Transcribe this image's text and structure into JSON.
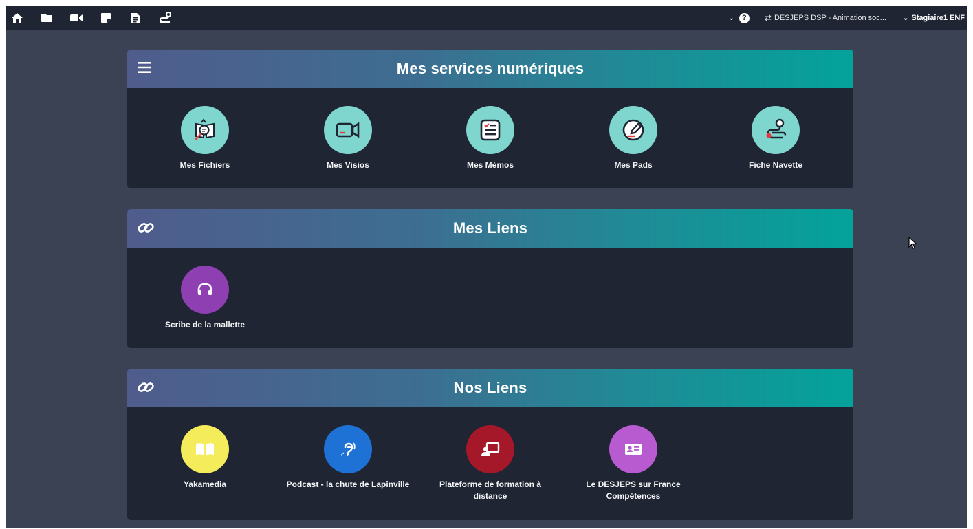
{
  "topbar": {
    "nav_icons": [
      "home-icon",
      "folder-icon",
      "video-camera-icon",
      "sticky-note-icon",
      "document-icon",
      "route-icon"
    ],
    "help_label": "?",
    "context_label": "DESJEPS DSP - Animation soc...",
    "user_label": "Stagiaire1 ENF"
  },
  "services": {
    "title": "Mes services numériques",
    "tiles": [
      {
        "label": "Mes Fichiers",
        "icon": "book-search-icon",
        "color": "#7ed6cf"
      },
      {
        "label": "Mes Visios",
        "icon": "video-icon",
        "color": "#7ed6cf"
      },
      {
        "label": "Mes Mémos",
        "icon": "memo-icon",
        "color": "#7ed6cf"
      },
      {
        "label": "Mes Pads",
        "icon": "pad-icon",
        "color": "#7ed6cf"
      },
      {
        "label": "Fiche Navette",
        "icon": "route-icon",
        "color": "#7ed6cf"
      }
    ]
  },
  "my_links": {
    "title": "Mes Liens",
    "tiles": [
      {
        "label": "Scribe de la mallette",
        "icon": "headphones-icon",
        "color": "#8e3fb2"
      }
    ]
  },
  "our_links": {
    "title": "Nos Liens",
    "tiles": [
      {
        "label": "Yakamedia",
        "icon": "book-open-icon",
        "color": "#f5ec5b"
      },
      {
        "label": "Podcast - la chute de Lapinville",
        "icon": "ear-icon",
        "color": "#1e72d6"
      },
      {
        "label": "Plateforme de formation à distance",
        "icon": "teacher-board-icon",
        "color": "#a5182a"
      },
      {
        "label": "Le DESJEPS sur France Compétences",
        "icon": "id-card-icon",
        "color": "#b85bd1"
      }
    ]
  },
  "colors": {
    "background": "#3a4253",
    "topbar": "#1f2532",
    "panel": "#1f2532",
    "header_gradient_start": "#505c8c",
    "header_gradient_end": "#03a39a"
  }
}
